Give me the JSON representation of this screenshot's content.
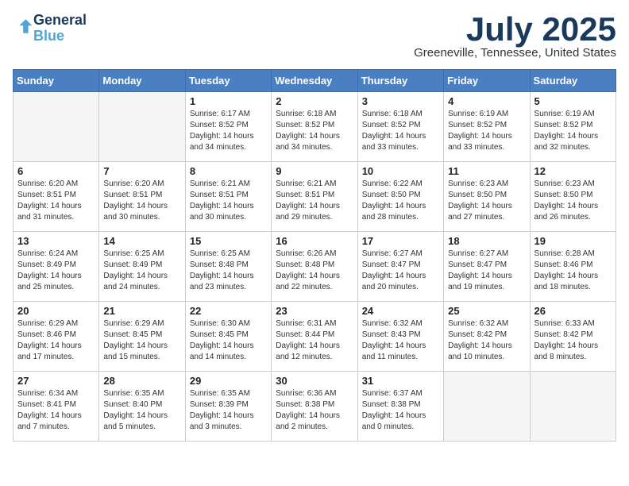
{
  "header": {
    "logo_line1": "General",
    "logo_line2": "Blue",
    "month_title": "July 2025",
    "location": "Greeneville, Tennessee, United States"
  },
  "weekdays": [
    "Sunday",
    "Monday",
    "Tuesday",
    "Wednesday",
    "Thursday",
    "Friday",
    "Saturday"
  ],
  "weeks": [
    [
      {
        "day": "",
        "sunrise": "",
        "sunset": "",
        "daylight": ""
      },
      {
        "day": "",
        "sunrise": "",
        "sunset": "",
        "daylight": ""
      },
      {
        "day": "1",
        "sunrise": "Sunrise: 6:17 AM",
        "sunset": "Sunset: 8:52 PM",
        "daylight": "Daylight: 14 hours and 34 minutes."
      },
      {
        "day": "2",
        "sunrise": "Sunrise: 6:18 AM",
        "sunset": "Sunset: 8:52 PM",
        "daylight": "Daylight: 14 hours and 34 minutes."
      },
      {
        "day": "3",
        "sunrise": "Sunrise: 6:18 AM",
        "sunset": "Sunset: 8:52 PM",
        "daylight": "Daylight: 14 hours and 33 minutes."
      },
      {
        "day": "4",
        "sunrise": "Sunrise: 6:19 AM",
        "sunset": "Sunset: 8:52 PM",
        "daylight": "Daylight: 14 hours and 33 minutes."
      },
      {
        "day": "5",
        "sunrise": "Sunrise: 6:19 AM",
        "sunset": "Sunset: 8:52 PM",
        "daylight": "Daylight: 14 hours and 32 minutes."
      }
    ],
    [
      {
        "day": "6",
        "sunrise": "Sunrise: 6:20 AM",
        "sunset": "Sunset: 8:51 PM",
        "daylight": "Daylight: 14 hours and 31 minutes."
      },
      {
        "day": "7",
        "sunrise": "Sunrise: 6:20 AM",
        "sunset": "Sunset: 8:51 PM",
        "daylight": "Daylight: 14 hours and 30 minutes."
      },
      {
        "day": "8",
        "sunrise": "Sunrise: 6:21 AM",
        "sunset": "Sunset: 8:51 PM",
        "daylight": "Daylight: 14 hours and 30 minutes."
      },
      {
        "day": "9",
        "sunrise": "Sunrise: 6:21 AM",
        "sunset": "Sunset: 8:51 PM",
        "daylight": "Daylight: 14 hours and 29 minutes."
      },
      {
        "day": "10",
        "sunrise": "Sunrise: 6:22 AM",
        "sunset": "Sunset: 8:50 PM",
        "daylight": "Daylight: 14 hours and 28 minutes."
      },
      {
        "day": "11",
        "sunrise": "Sunrise: 6:23 AM",
        "sunset": "Sunset: 8:50 PM",
        "daylight": "Daylight: 14 hours and 27 minutes."
      },
      {
        "day": "12",
        "sunrise": "Sunrise: 6:23 AM",
        "sunset": "Sunset: 8:50 PM",
        "daylight": "Daylight: 14 hours and 26 minutes."
      }
    ],
    [
      {
        "day": "13",
        "sunrise": "Sunrise: 6:24 AM",
        "sunset": "Sunset: 8:49 PM",
        "daylight": "Daylight: 14 hours and 25 minutes."
      },
      {
        "day": "14",
        "sunrise": "Sunrise: 6:25 AM",
        "sunset": "Sunset: 8:49 PM",
        "daylight": "Daylight: 14 hours and 24 minutes."
      },
      {
        "day": "15",
        "sunrise": "Sunrise: 6:25 AM",
        "sunset": "Sunset: 8:48 PM",
        "daylight": "Daylight: 14 hours and 23 minutes."
      },
      {
        "day": "16",
        "sunrise": "Sunrise: 6:26 AM",
        "sunset": "Sunset: 8:48 PM",
        "daylight": "Daylight: 14 hours and 22 minutes."
      },
      {
        "day": "17",
        "sunrise": "Sunrise: 6:27 AM",
        "sunset": "Sunset: 8:47 PM",
        "daylight": "Daylight: 14 hours and 20 minutes."
      },
      {
        "day": "18",
        "sunrise": "Sunrise: 6:27 AM",
        "sunset": "Sunset: 8:47 PM",
        "daylight": "Daylight: 14 hours and 19 minutes."
      },
      {
        "day": "19",
        "sunrise": "Sunrise: 6:28 AM",
        "sunset": "Sunset: 8:46 PM",
        "daylight": "Daylight: 14 hours and 18 minutes."
      }
    ],
    [
      {
        "day": "20",
        "sunrise": "Sunrise: 6:29 AM",
        "sunset": "Sunset: 8:46 PM",
        "daylight": "Daylight: 14 hours and 17 minutes."
      },
      {
        "day": "21",
        "sunrise": "Sunrise: 6:29 AM",
        "sunset": "Sunset: 8:45 PM",
        "daylight": "Daylight: 14 hours and 15 minutes."
      },
      {
        "day": "22",
        "sunrise": "Sunrise: 6:30 AM",
        "sunset": "Sunset: 8:45 PM",
        "daylight": "Daylight: 14 hours and 14 minutes."
      },
      {
        "day": "23",
        "sunrise": "Sunrise: 6:31 AM",
        "sunset": "Sunset: 8:44 PM",
        "daylight": "Daylight: 14 hours and 12 minutes."
      },
      {
        "day": "24",
        "sunrise": "Sunrise: 6:32 AM",
        "sunset": "Sunset: 8:43 PM",
        "daylight": "Daylight: 14 hours and 11 minutes."
      },
      {
        "day": "25",
        "sunrise": "Sunrise: 6:32 AM",
        "sunset": "Sunset: 8:42 PM",
        "daylight": "Daylight: 14 hours and 10 minutes."
      },
      {
        "day": "26",
        "sunrise": "Sunrise: 6:33 AM",
        "sunset": "Sunset: 8:42 PM",
        "daylight": "Daylight: 14 hours and 8 minutes."
      }
    ],
    [
      {
        "day": "27",
        "sunrise": "Sunrise: 6:34 AM",
        "sunset": "Sunset: 8:41 PM",
        "daylight": "Daylight: 14 hours and 7 minutes."
      },
      {
        "day": "28",
        "sunrise": "Sunrise: 6:35 AM",
        "sunset": "Sunset: 8:40 PM",
        "daylight": "Daylight: 14 hours and 5 minutes."
      },
      {
        "day": "29",
        "sunrise": "Sunrise: 6:35 AM",
        "sunset": "Sunset: 8:39 PM",
        "daylight": "Daylight: 14 hours and 3 minutes."
      },
      {
        "day": "30",
        "sunrise": "Sunrise: 6:36 AM",
        "sunset": "Sunset: 8:38 PM",
        "daylight": "Daylight: 14 hours and 2 minutes."
      },
      {
        "day": "31",
        "sunrise": "Sunrise: 6:37 AM",
        "sunset": "Sunset: 8:38 PM",
        "daylight": "Daylight: 14 hours and 0 minutes."
      },
      {
        "day": "",
        "sunrise": "",
        "sunset": "",
        "daylight": ""
      },
      {
        "day": "",
        "sunrise": "",
        "sunset": "",
        "daylight": ""
      }
    ]
  ]
}
